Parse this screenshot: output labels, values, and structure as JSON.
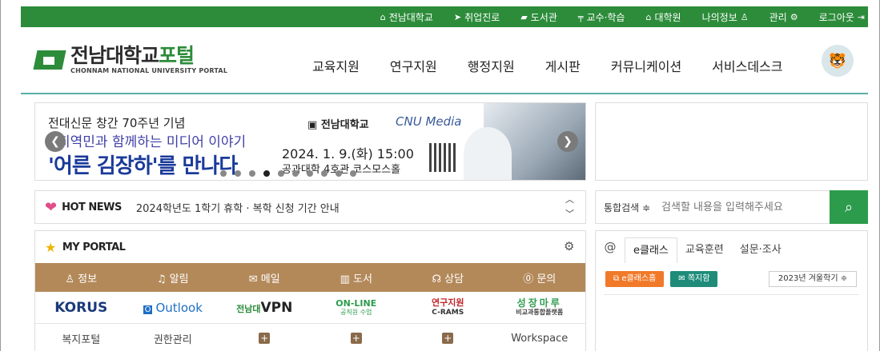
{
  "topbar": {
    "items": [
      {
        "icon": "building-icon",
        "glyph": "⌂",
        "label": "전남대학교"
      },
      {
        "icon": "plane-icon",
        "glyph": "➤",
        "label": "취업진로"
      },
      {
        "icon": "book-icon",
        "glyph": "▰",
        "label": "도서관"
      },
      {
        "icon": "chair-icon",
        "glyph": "╤",
        "label": "교수·학습"
      },
      {
        "icon": "building-icon",
        "glyph": "⌂",
        "label": "대학원"
      }
    ],
    "my_info": "나의정보",
    "admin": "관리",
    "logout": "로그아웃"
  },
  "header": {
    "logo_main": "전남대학교",
    "logo_accent": "포털",
    "logo_sub": "CHONNAM NATIONAL UNIVERSITY PORTAL",
    "nav": [
      "교육지원",
      "연구지원",
      "행정지원",
      "게시판",
      "커뮤니케이션",
      "서비스데스크"
    ]
  },
  "banner": {
    "line1": "전대신문 창간 70주년 기념",
    "line2": "지역민과 함께하는 미디어 이야기",
    "line3": "'어른 김장하'를 만나다",
    "org_logo": "전남대학교",
    "media_logo": "CNU Media",
    "date": "2024. 1. 9.(화) 15:00",
    "place": "공과대학 4호관 코스모스홀",
    "slide_count": 10,
    "active_slide": 3
  },
  "hotnews": {
    "label": "HOT NEWS",
    "text": "2024학년도 1학기 휴학 · 복학 신청 기간 안내"
  },
  "search": {
    "scope": "통합검색 ≑",
    "placeholder": "검색할 내용을 입력해주세요"
  },
  "myportal": {
    "title": "MY PORTAL",
    "menu": [
      {
        "icon": "person-icon",
        "label": "♙ 정보"
      },
      {
        "icon": "bell-icon",
        "label": "♫ 알림"
      },
      {
        "icon": "mail-icon",
        "label": "✉ 메일"
      },
      {
        "icon": "book-icon",
        "label": "▥ 도서"
      },
      {
        "icon": "headset-icon",
        "label": "☊ 상담"
      },
      {
        "icon": "question-icon",
        "label": "⓪ 문의"
      }
    ],
    "links": {
      "korus": "KORUS",
      "outlook": "Outlook",
      "vpn_prefix": "전남대",
      "vpn": "VPN",
      "online": "ON-LINE",
      "online_sub": "공직원 수업",
      "rams": "연구지원",
      "rams_sub": "C-RAMS",
      "sung": "성장마루",
      "sung_sub": "비교과통합플랫폼"
    },
    "row3": [
      "복지포털",
      "권한관리",
      "+",
      "+",
      "+",
      "Workspace"
    ]
  },
  "tabs": {
    "at": "@",
    "items": [
      "e클래스",
      "교육훈련",
      "설문·조사"
    ],
    "active": 0,
    "btn_home": "e클래스홈",
    "btn_mail": "쪽지함",
    "term": "2023년 겨울학기 ≑"
  }
}
